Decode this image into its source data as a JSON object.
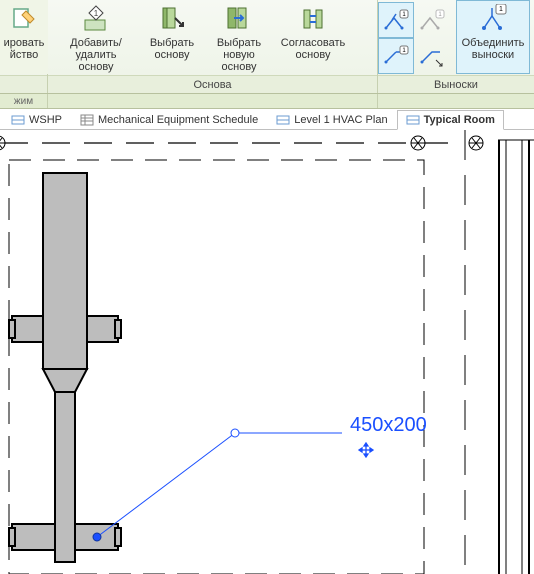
{
  "ribbon": {
    "groups": [
      {
        "label": "",
        "partial_button": {
          "label_line1": "ировать",
          "label_line2": "йство"
        }
      },
      {
        "label": "Основа",
        "buttons": [
          {
            "label_line1": "Добавить/удалить",
            "label_line2": "основу"
          },
          {
            "label_line1": "Выбрать",
            "label_line2": "основу"
          },
          {
            "label_line1": "Выбрать",
            "label_line2": "новую основу"
          },
          {
            "label_line1": "Согласовать",
            "label_line2": "основу"
          }
        ]
      },
      {
        "label": "Выноски",
        "merge_button": {
          "label_line1": "Объединить",
          "label_line2": "выноски"
        }
      }
    ]
  },
  "subbar": {
    "segments": [
      "жим",
      "",
      ""
    ]
  },
  "tabs": [
    {
      "label": "WSHP",
      "active": false
    },
    {
      "label": "Mechanical Equipment Schedule",
      "active": false
    },
    {
      "label": "Level 1 HVAC Plan",
      "active": false
    },
    {
      "label": "Typical Room",
      "active": true
    }
  ],
  "tag": {
    "text": "450x200"
  }
}
